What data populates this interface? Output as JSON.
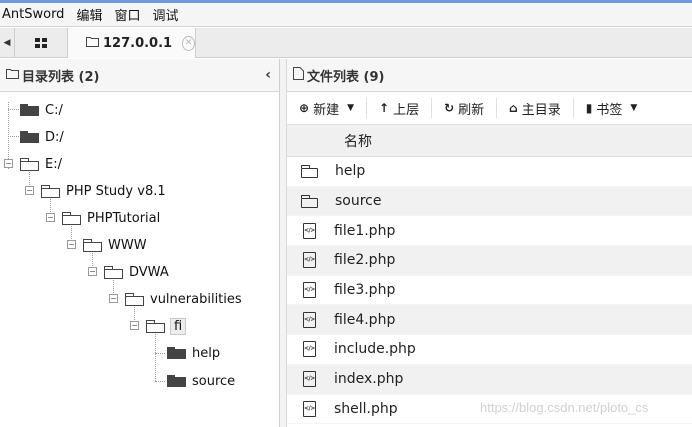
{
  "menu": [
    "AntSword",
    "编辑",
    "窗口",
    "调试"
  ],
  "tabs": {
    "host_label": "127.0.0.1"
  },
  "left_panel": {
    "title": "目录列表 (2)"
  },
  "tree": [
    {
      "label": "C:/",
      "open": false
    },
    {
      "label": "D:/",
      "open": false
    },
    {
      "label": "E:/",
      "open": true
    },
    {
      "label": "PHP Study v8.1",
      "open": true
    },
    {
      "label": "PHPTutorial",
      "open": true
    },
    {
      "label": "WWW",
      "open": true
    },
    {
      "label": "DVWA",
      "open": true
    },
    {
      "label": "vulnerabilities",
      "open": true
    },
    {
      "label": "fi",
      "open": true,
      "selected": true
    },
    {
      "label": "help",
      "open": false
    },
    {
      "label": "source",
      "open": false
    }
  ],
  "right_panel": {
    "title": "文件列表 (9)"
  },
  "toolbar": {
    "new": "新建",
    "up": "上层",
    "refresh": "刷新",
    "home": "主目录",
    "bookmark": "书签"
  },
  "files": {
    "column_name": "名称",
    "rows": [
      {
        "name": "help",
        "type": "folder"
      },
      {
        "name": "source",
        "type": "folder"
      },
      {
        "name": "file1.php",
        "type": "file"
      },
      {
        "name": "file2.php",
        "type": "file"
      },
      {
        "name": "file3.php",
        "type": "file"
      },
      {
        "name": "file4.php",
        "type": "file"
      },
      {
        "name": "include.php",
        "type": "file"
      },
      {
        "name": "index.php",
        "type": "file"
      },
      {
        "name": "shell.php",
        "type": "file"
      }
    ]
  },
  "watermark": "https://blog.csdn.net/ploto_cs"
}
